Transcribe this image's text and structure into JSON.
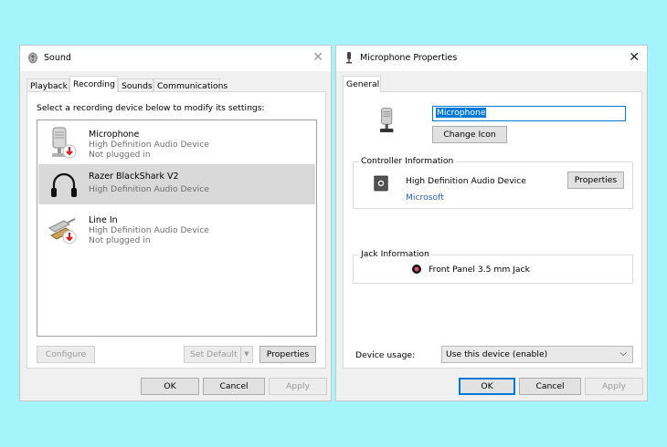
{
  "sound": {
    "title": "Sound",
    "tabs": [
      {
        "label": "Playback"
      },
      {
        "label": "Recording"
      },
      {
        "label": "Sounds"
      },
      {
        "label": "Communications"
      }
    ],
    "instruction": "Select a recording device below to modify its settings:",
    "devices": [
      {
        "name": "Microphone",
        "line1": "High Definition Audio Device",
        "line2": "Not plugged in",
        "icon": "microphone-icon"
      },
      {
        "name": "Razer BlackShark V2",
        "line1": "High Definition Audio Device",
        "line2": "",
        "icon": "headset-icon"
      },
      {
        "name": "Line In",
        "line1": "High Definition Audio Device",
        "line2": "Not plugged in",
        "icon": "line-in-icon"
      }
    ],
    "buttons": {
      "configure": "Configure",
      "set_default": "Set Default",
      "properties": "Properties",
      "ok": "OK",
      "cancel": "Cancel",
      "apply": "Apply"
    }
  },
  "mic_props": {
    "title": "Microphone Properties",
    "tab": "General",
    "device_name": "Microphone",
    "change_icon": "Change Icon",
    "controller": {
      "legend": "Controller Information",
      "name": "High Definition Audio Device",
      "vendor": "Microsoft",
      "properties": "Properties"
    },
    "jack": {
      "legend": "Jack Information",
      "text": "Front Panel 3.5 mm Jack",
      "color": "#e05070"
    },
    "usage": {
      "label": "Device usage:",
      "value": "Use this device (enable)"
    },
    "buttons": {
      "ok": "OK",
      "cancel": "Cancel",
      "apply": "Apply"
    }
  },
  "colors": {
    "accent": "#0078d7",
    "background": "#a4f4fb",
    "unplugged_badge": "#e02020"
  }
}
